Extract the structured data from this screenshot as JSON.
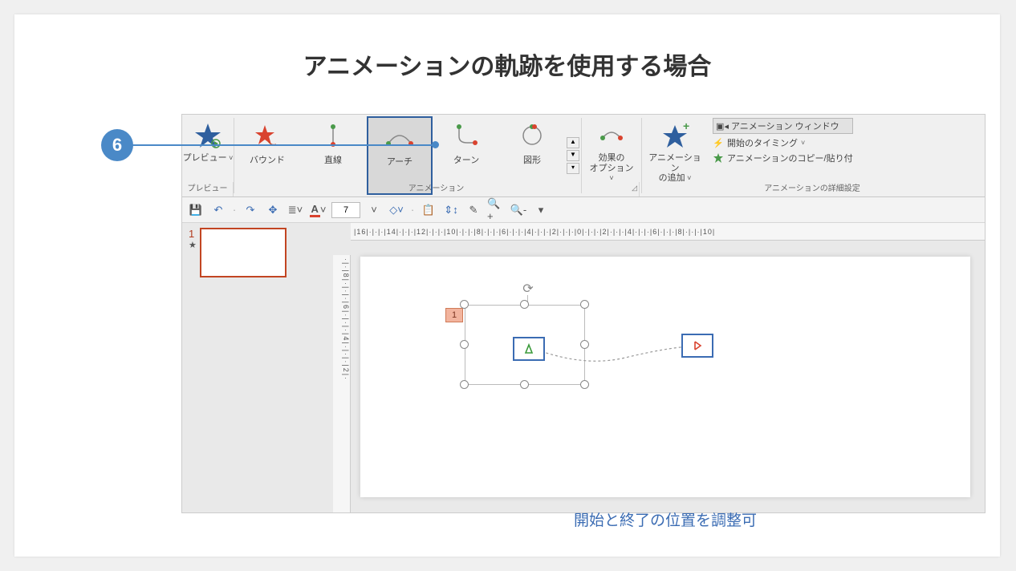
{
  "title": "アニメーションの軌跡を使用する場合",
  "step_number": "6",
  "ribbon": {
    "preview_label": "プレビュー",
    "preview_group_label": "プレビュー",
    "gallery": [
      {
        "label": "バウンド"
      },
      {
        "label": "直線"
      },
      {
        "label": "アーチ"
      },
      {
        "label": "ターン"
      },
      {
        "label": "図形"
      }
    ],
    "gallery_selected_index": 2,
    "gallery_group_label": "アニメーション",
    "effect_options_label": "効果の\nオプション",
    "add_anim_label": "アニメーション\nの追加",
    "adv_pane_label": "アニメーション ウィンドウ",
    "adv_timing_label": "開始のタイミング",
    "adv_copy_label": "アニメーションのコピー/貼り付",
    "adv_group_label": "アニメーションの詳細設定"
  },
  "qat": {
    "font_size_value": "7"
  },
  "thumbnail": {
    "number": "1",
    "star": "★"
  },
  "ruler_h_text": "|16|·|·|·|14|·|·|·|12|·|·|·|10|·|·|·|8|·|·|·|6|·|·|·|4|·|·|·|2|·|·|·|0|·|·|·|2|·|·|·|4|·|·|·|6|·|·|·|8|·|·|·|10|",
  "ruler_v_text": "·|·|8|·|·|·|6|·|·|·|4|·|·|·|2|·",
  "anim_tag_label": "1",
  "caption": "開始と終了の位置を調整可"
}
